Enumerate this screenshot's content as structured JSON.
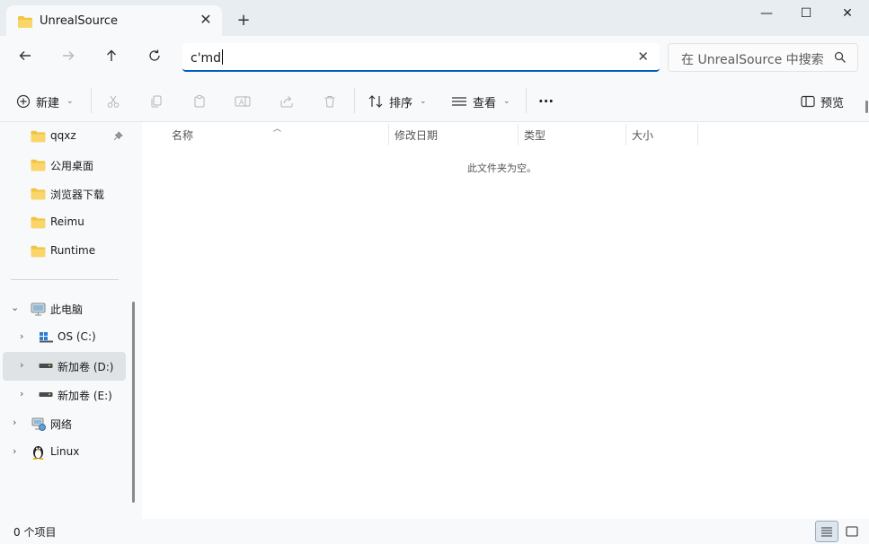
{
  "tab": {
    "title": "UnrealSource",
    "close_icon": "close-icon"
  },
  "window_controls": {
    "minimize": "—",
    "maximize": "☐",
    "close": "✕"
  },
  "address": {
    "value": "c'md"
  },
  "search": {
    "placeholder": "在 UnrealSource 中搜索"
  },
  "commands": {
    "new_label": "新建",
    "sort_label": "排序",
    "view_label": "查看",
    "more_label": "···",
    "preview_label": "预览"
  },
  "sidebar": {
    "pinned": [
      {
        "label": "qqxz"
      },
      {
        "label": "公用桌面"
      },
      {
        "label": "浏览器下载"
      },
      {
        "label": "Reimu"
      },
      {
        "label": "Runtime"
      }
    ],
    "this_pc": "此电脑",
    "drives": [
      {
        "label": "OS (C:)"
      },
      {
        "label": "新加卷 (D:)"
      },
      {
        "label": "新加卷 (E:)"
      }
    ],
    "network": "网络",
    "linux": "Linux"
  },
  "columns": {
    "name": "名称",
    "modified": "修改日期",
    "type": "类型",
    "size": "大小"
  },
  "empty_message": "此文件夹为空。",
  "status": {
    "item_count": "0 个项目"
  },
  "colors": {
    "accent": "#005fb8",
    "folder": "#f3c442"
  }
}
